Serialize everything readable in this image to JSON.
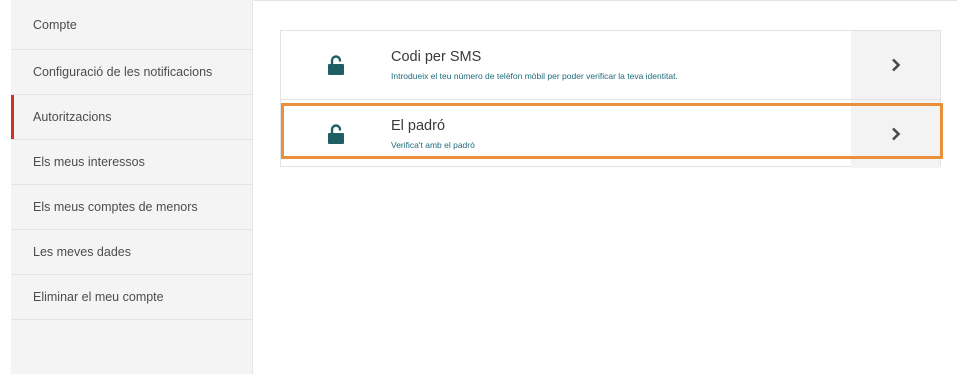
{
  "sidebar": {
    "items": [
      {
        "label": "Compte"
      },
      {
        "label": "Configuració de les notificacions"
      },
      {
        "label": "Autoritzacions"
      },
      {
        "label": "Els meus interessos"
      },
      {
        "label": "Els meus comptes de menors"
      },
      {
        "label": "Les meves dades"
      },
      {
        "label": "Eliminar el meu compte"
      }
    ],
    "active_index": 2
  },
  "authorizations": [
    {
      "title": "Codi per SMS",
      "description": "Introdueix el teu número de telèfon mòbil per poder verificar la teva identitat.",
      "icon": "unlocked-padlock-icon",
      "action_icon": "chevron-right-icon"
    },
    {
      "title": "El padró",
      "description": "Verifica't amb el padró",
      "icon": "unlocked-padlock-icon",
      "action_icon": "chevron-right-icon",
      "highlighted": true
    }
  ],
  "colors": {
    "accent_active": "#d4302a",
    "icon_teal": "#1f5f66",
    "description_teal": "#1e6b7a",
    "highlight_orange": "#e8913a"
  }
}
